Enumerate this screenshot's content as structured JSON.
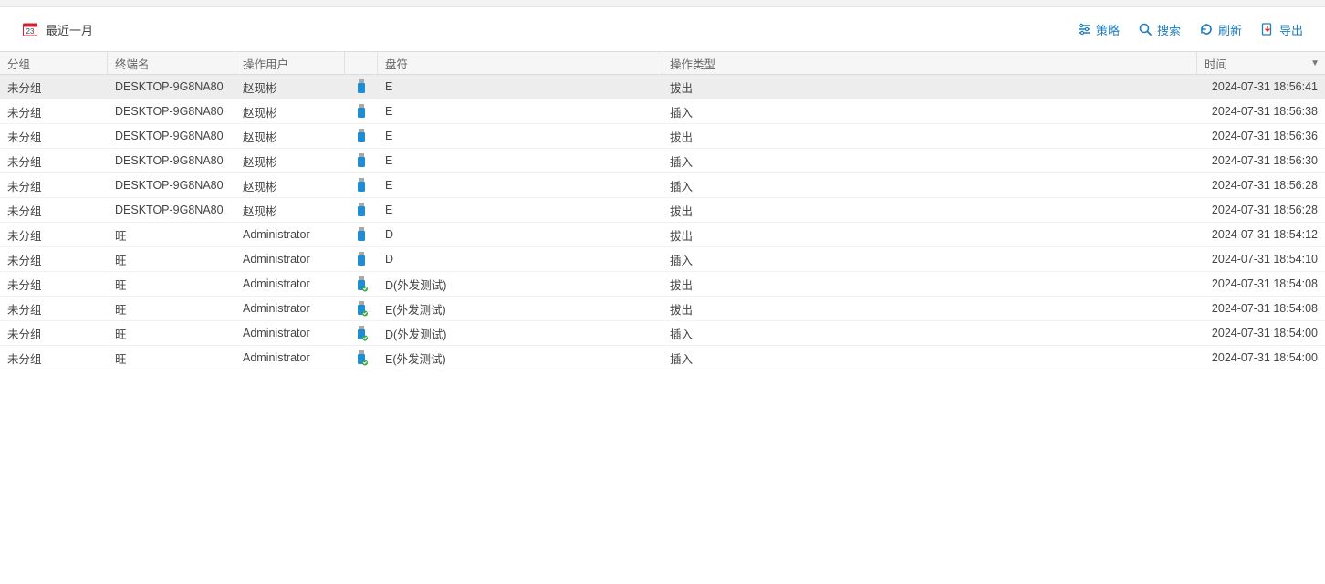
{
  "toolbar": {
    "date_filter": "最近一月",
    "buttons": {
      "strategy": "策略",
      "search": "搜索",
      "refresh": "刷新",
      "export": "导出"
    }
  },
  "columns": {
    "group": "分组",
    "terminal": "终端名",
    "user": "操作用户",
    "drive": "盘符",
    "action": "操作类型",
    "time": "时间"
  },
  "rows": [
    {
      "group": "未分组",
      "terminal": "DESKTOP-9G8NA80",
      "user": "赵现彬",
      "iconType": "usb",
      "drive": "E",
      "action": "拔出",
      "time": "2024-07-31 18:56:41",
      "selected": true
    },
    {
      "group": "未分组",
      "terminal": "DESKTOP-9G8NA80",
      "user": "赵现彬",
      "iconType": "usb",
      "drive": "E",
      "action": "插入",
      "time": "2024-07-31 18:56:38",
      "selected": false
    },
    {
      "group": "未分组",
      "terminal": "DESKTOP-9G8NA80",
      "user": "赵现彬",
      "iconType": "usb",
      "drive": "E",
      "action": "拔出",
      "time": "2024-07-31 18:56:36",
      "selected": false
    },
    {
      "group": "未分组",
      "terminal": "DESKTOP-9G8NA80",
      "user": "赵现彬",
      "iconType": "usb",
      "drive": "E",
      "action": "插入",
      "time": "2024-07-31 18:56:30",
      "selected": false
    },
    {
      "group": "未分组",
      "terminal": "DESKTOP-9G8NA80",
      "user": "赵现彬",
      "iconType": "usb",
      "drive": "E",
      "action": "插入",
      "time": "2024-07-31 18:56:28",
      "selected": false
    },
    {
      "group": "未分组",
      "terminal": "DESKTOP-9G8NA80",
      "user": "赵现彬",
      "iconType": "usb",
      "drive": "E",
      "action": "拔出",
      "time": "2024-07-31 18:56:28",
      "selected": false
    },
    {
      "group": "未分组",
      "terminal": "旺",
      "user": "Administrator",
      "iconType": "usb",
      "drive": "D",
      "action": "拔出",
      "time": "2024-07-31 18:54:12",
      "selected": false
    },
    {
      "group": "未分组",
      "terminal": "旺",
      "user": "Administrator",
      "iconType": "usb",
      "drive": "D",
      "action": "插入",
      "time": "2024-07-31 18:54:10",
      "selected": false
    },
    {
      "group": "未分组",
      "terminal": "旺",
      "user": "Administrator",
      "iconType": "usb-ok",
      "drive": "D(外发测试)",
      "action": "拔出",
      "time": "2024-07-31 18:54:08",
      "selected": false
    },
    {
      "group": "未分组",
      "terminal": "旺",
      "user": "Administrator",
      "iconType": "usb-ok",
      "drive": "E(外发测试)",
      "action": "拔出",
      "time": "2024-07-31 18:54:08",
      "selected": false
    },
    {
      "group": "未分组",
      "terminal": "旺",
      "user": "Administrator",
      "iconType": "usb-ok",
      "drive": "D(外发测试)",
      "action": "插入",
      "time": "2024-07-31 18:54:00",
      "selected": false
    },
    {
      "group": "未分组",
      "terminal": "旺",
      "user": "Administrator",
      "iconType": "usb-ok",
      "drive": "E(外发测试)",
      "action": "插入",
      "time": "2024-07-31 18:54:00",
      "selected": false
    }
  ]
}
